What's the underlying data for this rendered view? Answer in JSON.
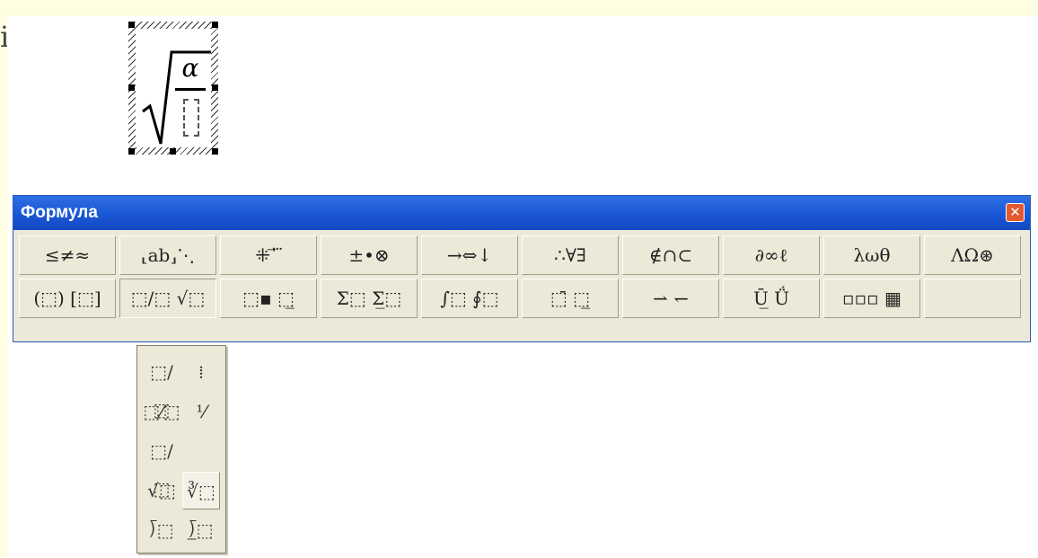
{
  "edge": {
    "glyph": "i"
  },
  "equation": {
    "numerator": "α",
    "denominator_placeholder": ""
  },
  "toolbar": {
    "title": "Формула",
    "close_glyph": "✕",
    "row1": [
      "≤≠≈",
      "⸤ab⸥⋱",
      "⁜ ⃗ ⃛",
      "±•⊗",
      "→⇔↓",
      "∴∀∃",
      "∉∩⊂",
      "∂∞ℓ",
      "λωθ",
      "ΛΩ⊛"
    ],
    "row2": [
      "(⬚) [⬚]",
      "⬚/⬚ √⬚",
      "⬚▪ ⬚̲",
      "Σ⬚ Σ̲⬚",
      "∫⬚ ∮⬚",
      "⬚̄ ⬚̲",
      "⇀ ↽",
      "Ū̲ Ǘ",
      "▫▫▫ ▦",
      ""
    ]
  },
  "palette": {
    "items": [
      "⬚/⬚",
      "⁞",
      "⬚⁄⬚",
      "⅟",
      "⬚/⬚",
      "",
      "√⬚",
      "∛⬚",
      "⟌⬚",
      "⟌̲⬚"
    ]
  }
}
